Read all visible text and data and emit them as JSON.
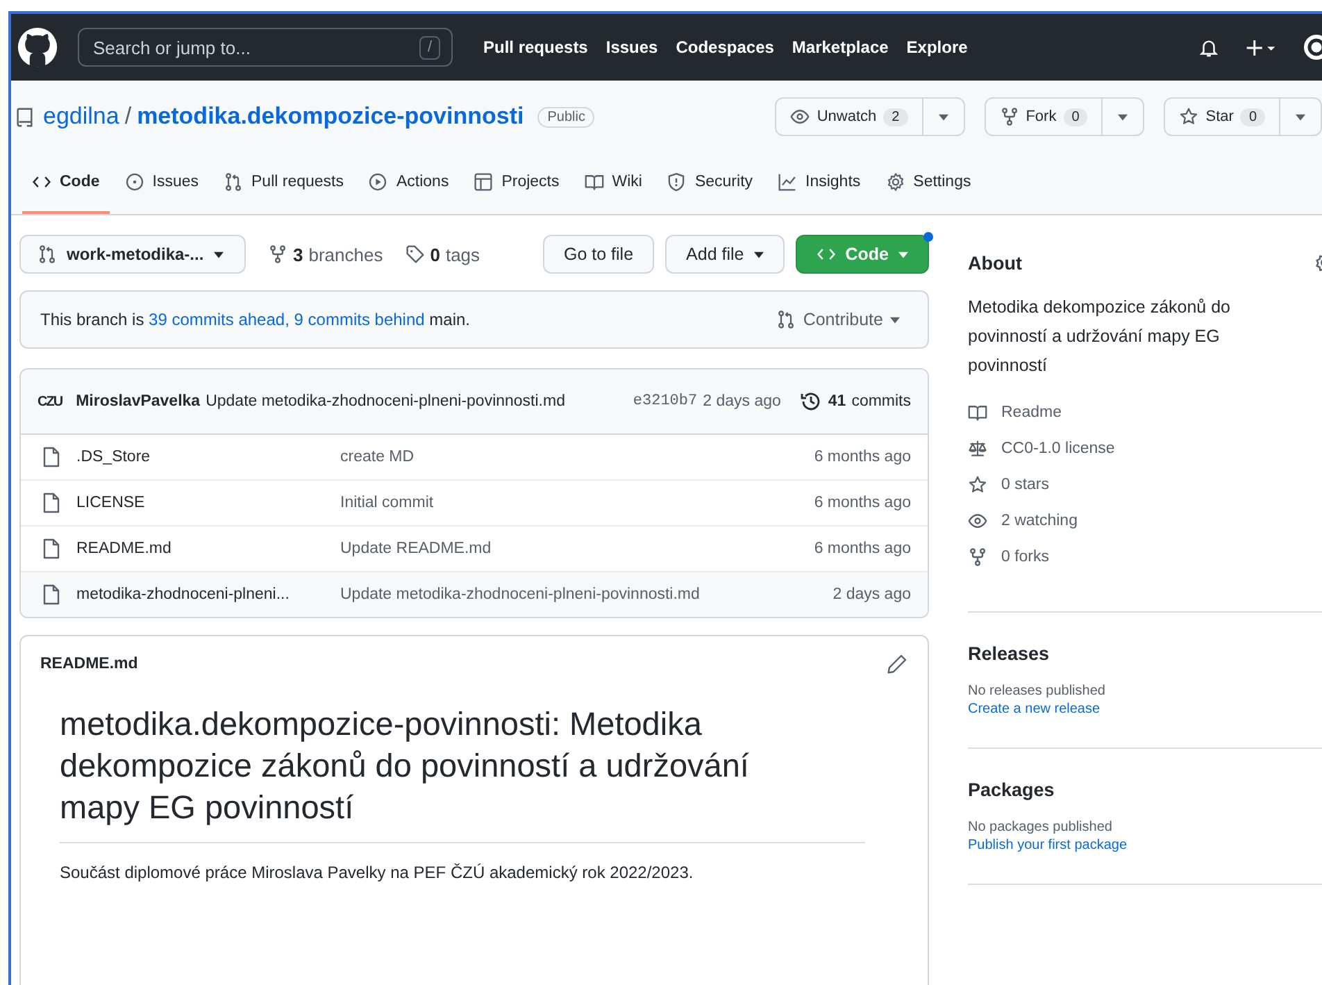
{
  "header": {
    "search": {
      "placeholder": "Search or jump to...",
      "shortcut": "/"
    },
    "nav": [
      "Pull requests",
      "Issues",
      "Codespaces",
      "Marketplace",
      "Explore"
    ]
  },
  "repo": {
    "owner": "egdilna",
    "separator": "/",
    "name": "metodika.dekompozice-povinnosti",
    "visibility": "Public",
    "actions": [
      {
        "label": "Unwatch",
        "count": "2"
      },
      {
        "label": "Fork",
        "count": "0"
      },
      {
        "label": "Star",
        "count": "0"
      }
    ]
  },
  "tabs": [
    {
      "label": "Code",
      "selected": true
    },
    {
      "label": "Issues",
      "selected": false
    },
    {
      "label": "Pull requests",
      "selected": false
    },
    {
      "label": "Actions",
      "selected": false
    },
    {
      "label": "Projects",
      "selected": false
    },
    {
      "label": "Wiki",
      "selected": false
    },
    {
      "label": "Security",
      "selected": false
    },
    {
      "label": "Insights",
      "selected": false
    },
    {
      "label": "Settings",
      "selected": false
    }
  ],
  "branch_bar": {
    "branch": "work-metodika-...",
    "branches_count": "3",
    "branches_label": "branches",
    "tags_count": "0",
    "tags_label": "tags",
    "buttons": [
      "Go to file",
      "Add file"
    ],
    "code_button": "Code"
  },
  "branch_status": {
    "prefix": "This branch is ",
    "ahead": "39 commits ahead,",
    "behind": "9 commits behind",
    "suffix": " main.",
    "contribute": "Contribute"
  },
  "latest_commit": {
    "avatar": "CZU",
    "author": "MiroslavPavelka",
    "message": "Update metodika-zhodnoceni-plneni-povinnosti.md",
    "sha": "e3210b7",
    "time": "2 days ago",
    "commits_count": "41",
    "commits_label": "commits"
  },
  "files": [
    {
      "name": ".DS_Store",
      "message": "create MD",
      "time": "6 months ago"
    },
    {
      "name": "LICENSE",
      "message": "Initial commit",
      "time": "6 months ago"
    },
    {
      "name": "README.md",
      "message": "Update README.md",
      "time": "6 months ago"
    },
    {
      "name": "metodika-zhodnoceni-plneni...",
      "message": "Update metodika-zhodnoceni-plneni-povinnosti.md",
      "time": "2 days ago"
    }
  ],
  "readme": {
    "filename": "README.md",
    "heading": "metodika.dekompozice-povinnosti: Metodika dekompozice zákonů do povinností a udržování mapy EG povinností",
    "text": "Součást diplomové práce Miroslava Pavelky na PEF ČZÚ akademický rok 2022/2023."
  },
  "about": {
    "title": "About",
    "description": "Metodika dekompozice zákonů do povinností a udržování mapy EG povinností",
    "items": [
      "Readme",
      "CC0-1.0 license",
      "0 stars",
      "2 watching",
      "0 forks"
    ]
  },
  "sections": [
    {
      "title": "Releases",
      "note": "No releases published",
      "link": "Create a new release"
    },
    {
      "title": "Packages",
      "note": "No packages published",
      "link": "Publish your first package"
    }
  ]
}
